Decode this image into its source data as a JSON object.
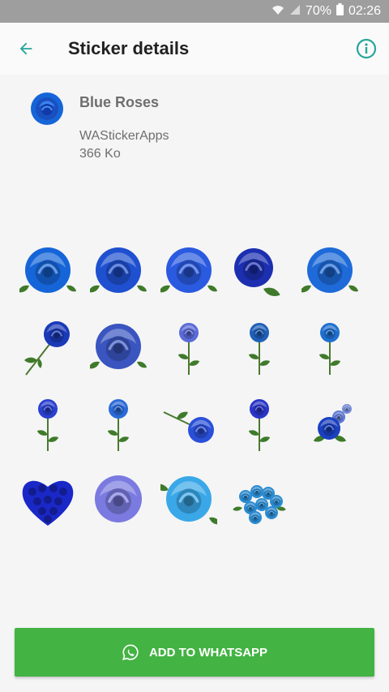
{
  "status_bar": {
    "battery": "70%",
    "time": "02:26"
  },
  "app_bar": {
    "title": "Sticker details",
    "back_icon": "arrow-left-icon",
    "info_icon": "info-icon"
  },
  "pack": {
    "name": "Blue Roses",
    "publisher": "WAStickerApps",
    "size": "366 Ko"
  },
  "stickers": [
    {
      "kind": "rose-head",
      "color": "#1565d8"
    },
    {
      "kind": "rose-head",
      "color": "#1e50d0"
    },
    {
      "kind": "rose-head",
      "color": "#2a5ae0"
    },
    {
      "kind": "rose-bud-leaf",
      "color": "#1c2fb0"
    },
    {
      "kind": "rose-head",
      "color": "#1e6ad8"
    },
    {
      "kind": "rose-stem-diagonal",
      "color": "#1a3ab8"
    },
    {
      "kind": "rose-head",
      "color": "#3a55c0"
    },
    {
      "kind": "rose-stem",
      "color": "#5a6ad8"
    },
    {
      "kind": "rose-stem",
      "color": "#1f5fb8"
    },
    {
      "kind": "rose-stem",
      "color": "#1f6fd0"
    },
    {
      "kind": "rose-stem",
      "color": "#2a40d0"
    },
    {
      "kind": "rose-stem",
      "color": "#2a6ad8"
    },
    {
      "kind": "rose-stem-horizontal",
      "color": "#2a50d8"
    },
    {
      "kind": "rose-stem",
      "color": "#2a35c8"
    },
    {
      "kind": "rose-bouquet-small",
      "color": "#1a40c0"
    },
    {
      "kind": "heart-roses",
      "color": "#1a28c8"
    },
    {
      "kind": "rose-head-gradient",
      "color": "#7a7ae0"
    },
    {
      "kind": "rose-head-light",
      "color": "#3aa8e8"
    },
    {
      "kind": "bouquet",
      "color": "#2a8ad0"
    }
  ],
  "add_button": {
    "label": "ADD TO WHATSAPP",
    "icon": "whatsapp-icon"
  },
  "colors": {
    "accent": "#26a69a",
    "button": "#43b343"
  }
}
